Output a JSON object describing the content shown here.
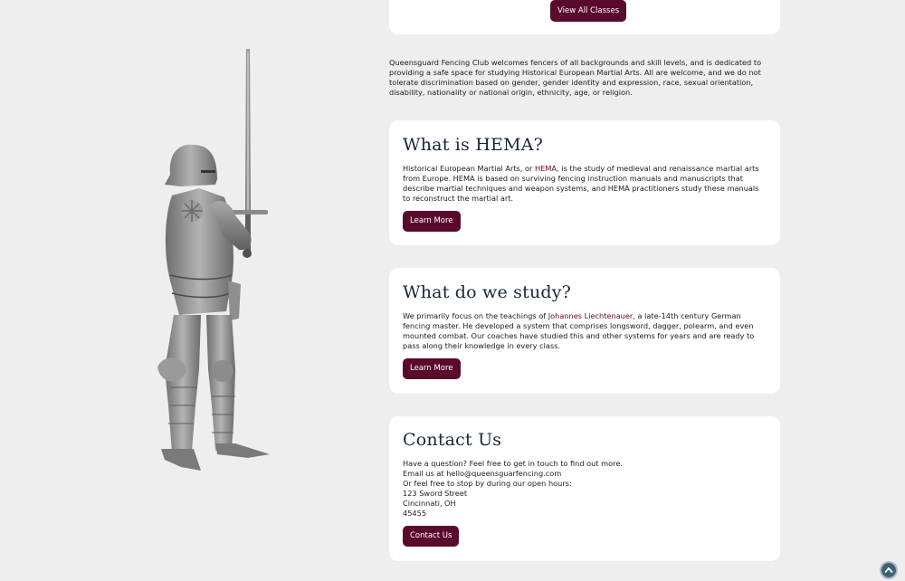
{
  "top_card": {
    "button_label": "View All Classes"
  },
  "intro_text": "Queensguard Fencing Club welcomes fencers of all backgrounds and skill levels, and is dedicated to providing a safe space for studying Historical European Martial Arts. All are welcome, and we do not tolerate discrimination based on gender, gender identity and expression, race, sexual orientation, disability, nationality or national origin, ethnicity, age, or religion.",
  "hema": {
    "title": "What is HEMA?",
    "text_before": "Historical European Martial Arts, or ",
    "link": "HEMA",
    "text_after": ", is the study of medieval and renaissance martial arts from Europe. HEMA is based on surviving fencing instruction manuals and manuscripts that describe martial techniques and weapon systems, and HEMA practitioners study these manuals to reconstruct the martial art.",
    "button_label": "Learn More"
  },
  "study": {
    "title": "What do we study?",
    "text_before": "We primarily focus on the teachings of ",
    "link": "Johannes Liechtenauer",
    "text_after": ", a late-14th century German fencing master. He developed a system that comprises longsword, dagger, polearm, and even mounted combat. Our coaches have studied this and other systems for years and are ready to pass along their knowledge in every class.",
    "button_label": "Learn More"
  },
  "contact": {
    "title": "Contact Us",
    "lines": [
      "Have a question? Feel free to get in touch to find out more.",
      "Email us at hello@queensguarfencing.com",
      "Or feel free to stop by during our open hours:",
      "123 Sword Street",
      "Cincinnati, OH",
      "45455"
    ],
    "button_label": "Contact Us"
  },
  "icons": {
    "knight": "knight-illustration",
    "scroll_top": "chevron-up-icon"
  },
  "colors": {
    "background": "#eeeeee",
    "card": "#ffffff",
    "accent": "#5a0b2d",
    "heading": "#16263d",
    "scroll_button": "#3f6272"
  }
}
